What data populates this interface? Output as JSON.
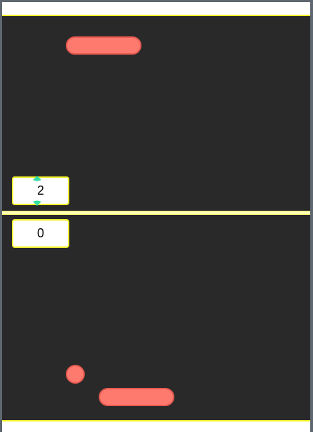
{
  "game": {
    "score_top": "2",
    "score_bottom": "0"
  },
  "colors": {
    "court_background": "#2a292a",
    "court_border": "#f2f22a",
    "midline": "#fdfdb5",
    "paddle": "#ff7a6e",
    "ball": "#ff7a6e",
    "score_box_border": "#f2f22a",
    "spinner_arrows": "#33e0a0"
  },
  "icons": {
    "increment": "caret-up-icon",
    "decrement": "caret-down-icon"
  }
}
